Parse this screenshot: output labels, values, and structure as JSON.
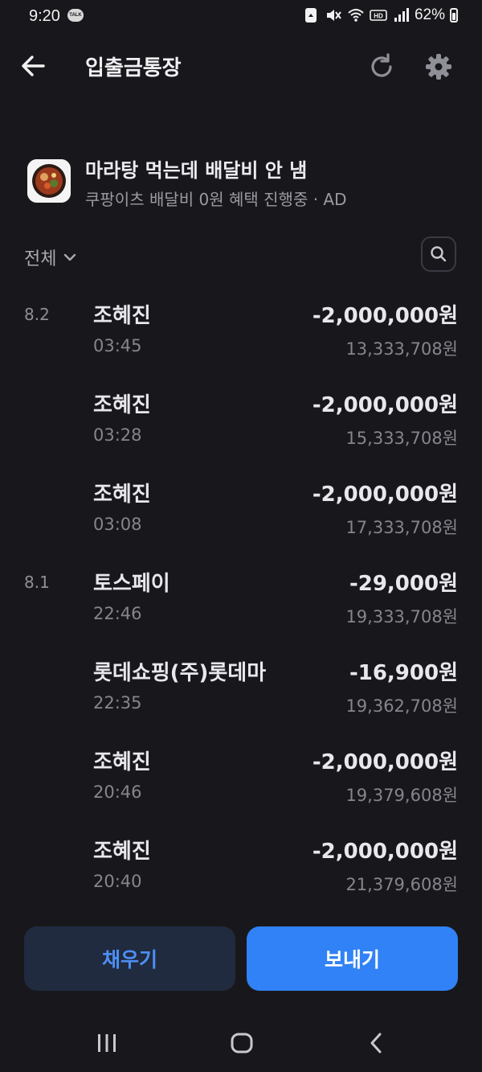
{
  "status_bar": {
    "time": "9:20",
    "talk_badge": "TALK",
    "battery": "62%"
  },
  "header": {
    "title": "입출금통장"
  },
  "ad": {
    "title": "마라탕 먹는데 배달비 안 냄",
    "subtitle": "쿠팡이츠 배달비 0원 혜택 진행중 · AD"
  },
  "filter": {
    "label": "전체"
  },
  "transactions": [
    {
      "date": "8.2",
      "name": "조혜진",
      "time": "03:45",
      "amount": "-2,000,000원",
      "balance": "13,333,708원"
    },
    {
      "date": "",
      "name": "조혜진",
      "time": "03:28",
      "amount": "-2,000,000원",
      "balance": "15,333,708원"
    },
    {
      "date": "",
      "name": "조혜진",
      "time": "03:08",
      "amount": "-2,000,000원",
      "balance": "17,333,708원"
    },
    {
      "date": "8.1",
      "name": "토스페이",
      "time": "22:46",
      "amount": "-29,000원",
      "balance": "19,333,708원"
    },
    {
      "date": "",
      "name": "롯데쇼핑(주)롯데마",
      "time": "22:35",
      "amount": "-16,900원",
      "balance": "19,362,708원"
    },
    {
      "date": "",
      "name": "조혜진",
      "time": "20:46",
      "amount": "-2,000,000원",
      "balance": "19,379,608원"
    },
    {
      "date": "",
      "name": "조혜진",
      "time": "20:40",
      "amount": "-2,000,000원",
      "balance": "21,379,608원"
    }
  ],
  "actions": {
    "charge_label": "채우기",
    "send_label": "보내기"
  },
  "colors": {
    "background": "#18181c",
    "primary": "#3182f6",
    "secondary_button": "#202b3f"
  }
}
